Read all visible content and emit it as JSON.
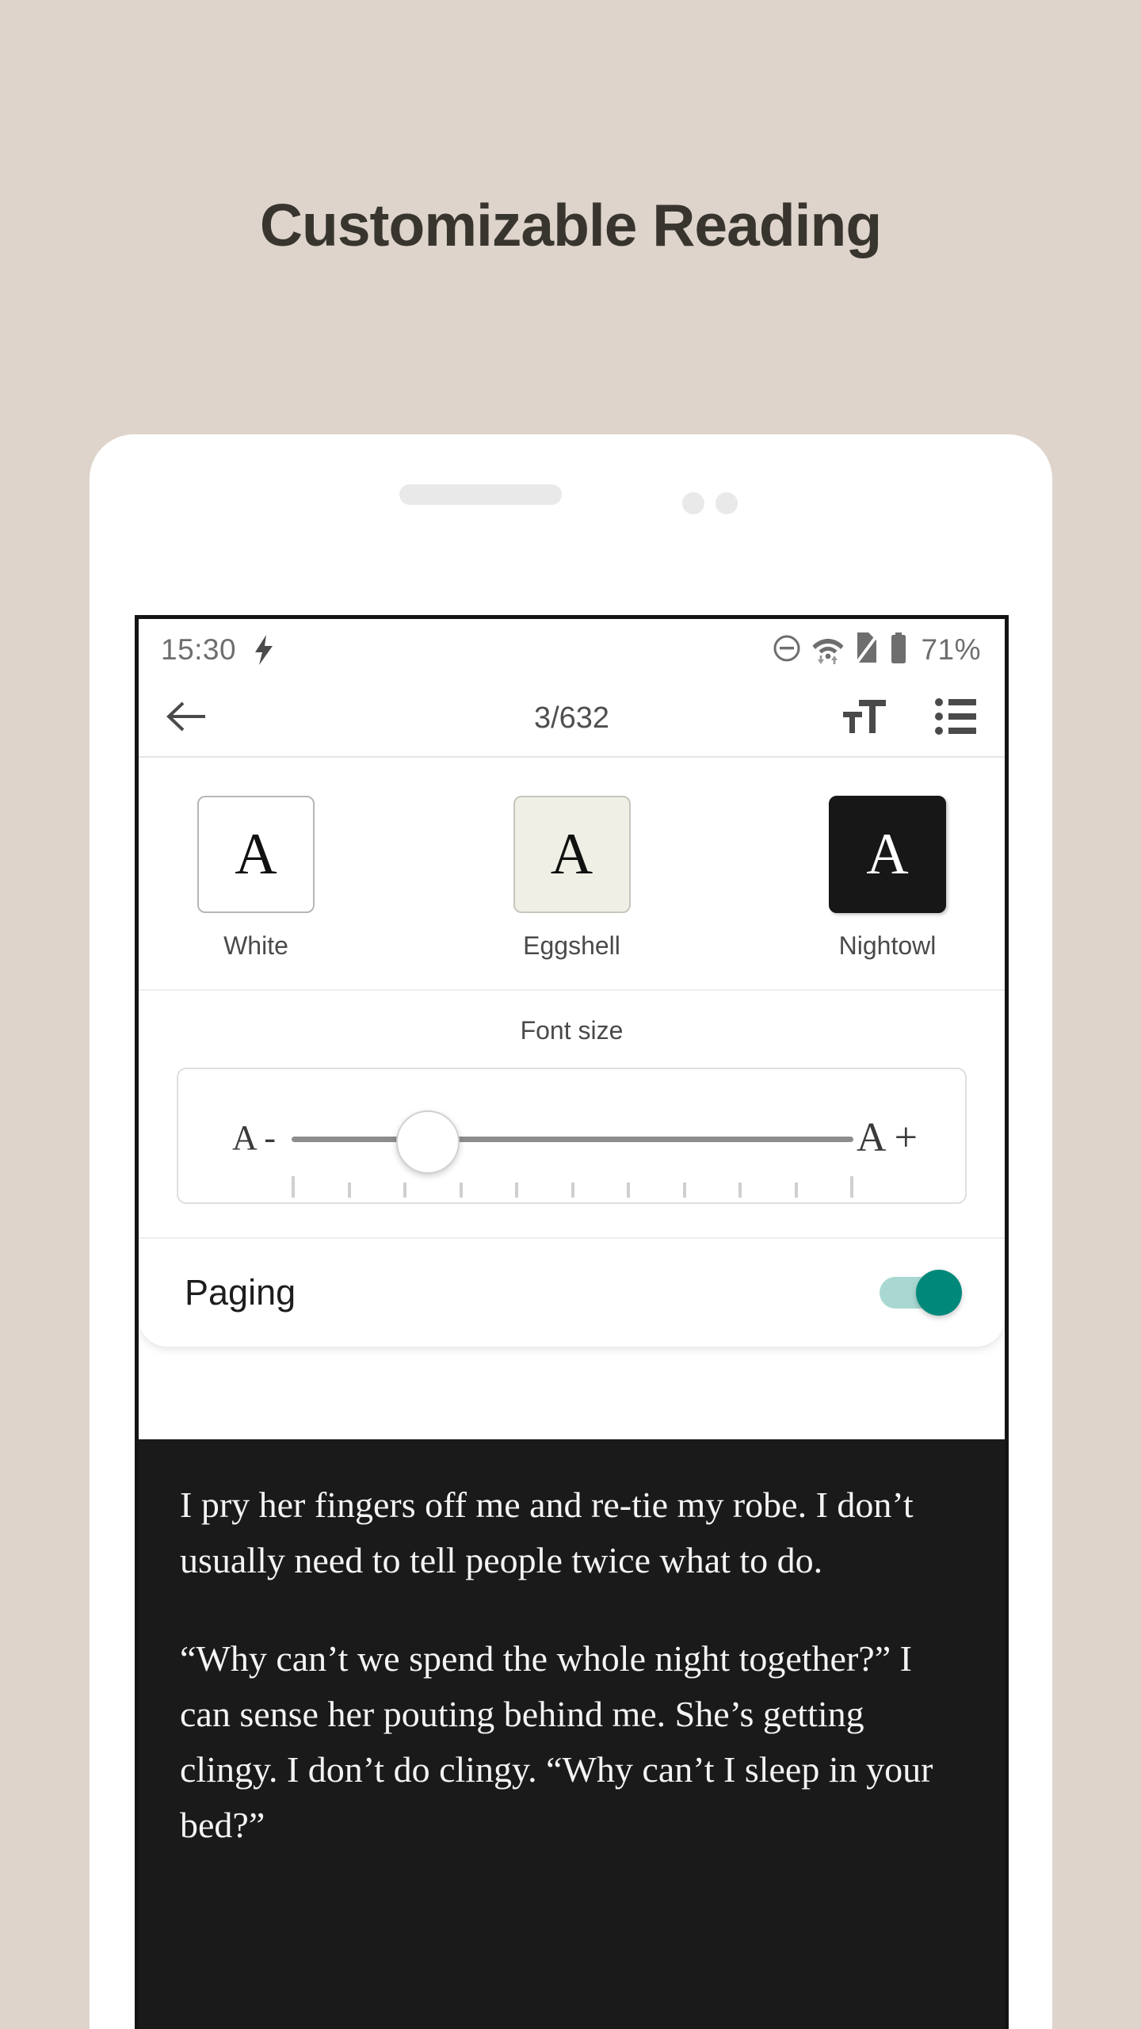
{
  "hero": {
    "title": "Customizable Reading"
  },
  "status_bar": {
    "time": "15:30",
    "charging_icon": "lightning-bolt-icon",
    "dnd_icon": "do-not-disturb-icon",
    "wifi_icon": "wifi-transfer-icon",
    "sim_icon": "no-sim-icon",
    "battery_icon": "battery-icon",
    "battery_percent": "71%"
  },
  "toolbar": {
    "back_icon": "back-arrow-icon",
    "page_indicator": "3/632",
    "font_size_icon": "text-size-icon",
    "toc_icon": "table-of-contents-icon"
  },
  "settings": {
    "themes": [
      {
        "label": "White",
        "sample": "A",
        "bg": "#ffffff",
        "fg": "#111111",
        "selected": false
      },
      {
        "label": "Eggshell",
        "sample": "A",
        "bg": "#efefe6",
        "fg": "#111111",
        "selected": false
      },
      {
        "label": "Nightowl",
        "sample": "A",
        "bg": "#171717",
        "fg": "#ffffff",
        "selected": true
      }
    ],
    "font_size": {
      "title": "Font size",
      "decrease_label": "A -",
      "increase_label": "A +",
      "thumb_position_percent": 31.5,
      "tick_count": 11
    },
    "paging": {
      "label": "Paging",
      "enabled": true,
      "on_color": "#00897b",
      "track_color": "#a9d8d2"
    }
  },
  "reader": {
    "background": "#1a1a1a",
    "text_color": "#f4f4f4",
    "paragraphs": [
      "I pry her fingers off me and re-tie my robe. I don’t usually need to tell people twice what to do.",
      "“Why can’t we spend the whole night together?” I can sense her pouting behind me. She’s getting clingy. I don’t do clingy. “Why can’t I sleep in your bed?”"
    ]
  },
  "colors": {
    "page_background": "#ded4cb",
    "title": "#38352f",
    "accent": "#00897b"
  }
}
